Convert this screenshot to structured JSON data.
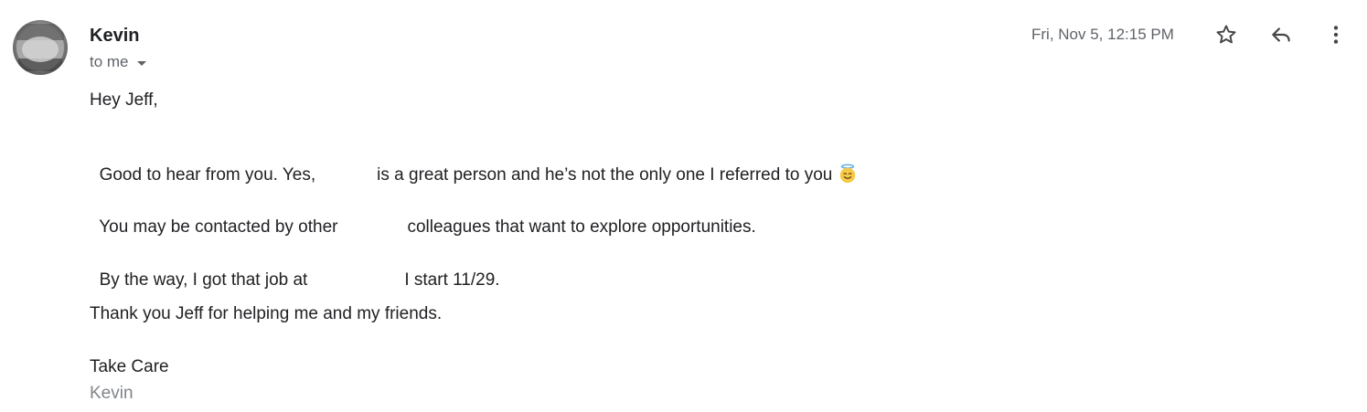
{
  "email": {
    "sender": "Kevin",
    "recipient": "to me",
    "date": "Fri, Nov 5, 12:15 PM",
    "icons": {
      "avatar": "avatar",
      "caret": "caret-down-icon",
      "star": "star-icon",
      "reply": "reply-icon",
      "more": "more-vert-icon",
      "emoji": "smiling-face-with-halo-emoji"
    }
  },
  "body": {
    "greeting": "Hey Jeff,",
    "para1_a": "Good to hear from you. Yes,",
    "para1_b": "is a great person and he’s not the only one I referred to you",
    "para2_a": "You may be contacted by other",
    "para2_b": "colleagues that want to explore opportunities.",
    "para3_a": "By the way, I got that job at",
    "para3_b": "I start 11/29.",
    "para4": "Thank you Jeff for helping me and my friends.",
    "closing": "Take Care",
    "signature": "Kevin"
  },
  "colors": {
    "primary_text": "#202124",
    "secondary_text": "#5f6368",
    "signature_text": "#80868b",
    "emoji_face": "#f7c948"
  }
}
